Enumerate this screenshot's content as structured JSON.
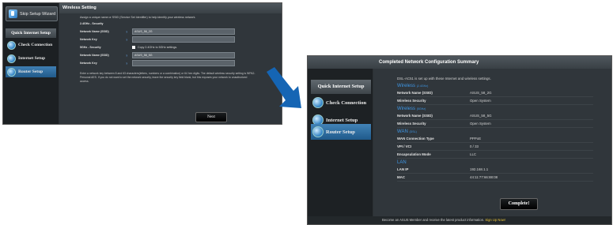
{
  "left_screen": {
    "skip_button": "Skip Setup Wizard",
    "sidebar_title": "Quick Internet Setup",
    "sidebar_items": [
      "Check Connection",
      "Internet Setup",
      "Router Setup"
    ],
    "header_title": "Wireless Setting",
    "intro": "Assign a unique name or SSID (Service Set Identifier) to help identify your wireless network.",
    "section_24": "2.4GHz - Security",
    "section_5": "5GHz - Security",
    "fields": {
      "ssid_24_label": "Network Name (SSID)",
      "ssid_24_value": "ASUS_58_2G",
      "key_24_label": "Network Key",
      "key_24_value": "",
      "copy_label": "Copy 2.4GHz to 5GHz settings.",
      "ssid_5_label": "Network Name (SSID)",
      "ssid_5_value": "ASUS_58_5G",
      "key_5_label": "Network Key",
      "key_5_value": ""
    },
    "note": "Enter a network key between 8 and 63 characters(letters, numbers or a combination) or 64 hex digits. The default wireless security setting is WPA2-Personal AES. If you do not want to set the network security, leave the security key field blank, but this exposes your network to unauthorized access.",
    "next_button": "Next"
  },
  "right_screen": {
    "header_title": "Completed Network Configuration Summary",
    "sidebar_title": "Quick Internet Setup",
    "sidebar_items": [
      "Check Connection",
      "Internet Setup",
      "Router Setup"
    ],
    "intro": "DSL-AC51 is set up with these Internet and wireless settings.",
    "sections": [
      {
        "title": "Wireless",
        "subtitle": "(2.4GHz)",
        "rows": [
          {
            "label": "Network Name (SSID)",
            "value": "ASUS_58_2G"
          },
          {
            "label": "Wireless Security",
            "value": "Open System"
          }
        ]
      },
      {
        "title": "Wireless",
        "subtitle": "(5GHz)",
        "rows": [
          {
            "label": "Network Name (SSID)",
            "value": "ASUS_58_5G"
          },
          {
            "label": "Wireless Security",
            "value": "Open System"
          }
        ]
      },
      {
        "title": "WAN",
        "subtitle": "(DSL)",
        "rows": [
          {
            "label": "WAN Connection Type",
            "value": "PPPoE"
          },
          {
            "label": "VPI / VCI",
            "value": "0 / 33"
          },
          {
            "label": "Encapsulation Mode",
            "value": "LLC"
          }
        ]
      },
      {
        "title": "LAN",
        "subtitle": "",
        "rows": [
          {
            "label": "LAN IP",
            "value": "192.168.1.1"
          },
          {
            "label": "MAC",
            "value": "44:11:77:66:88:08"
          }
        ]
      }
    ],
    "complete_button": "Complete!",
    "footer_text": "Become an ASUS Member and receive the latest product information.",
    "footer_link": "Sign Up Now!"
  },
  "colors": {
    "accent_blue": "#3e97e6",
    "active_item": "#2f6fa3",
    "link_yellow": "#e7c23a"
  }
}
